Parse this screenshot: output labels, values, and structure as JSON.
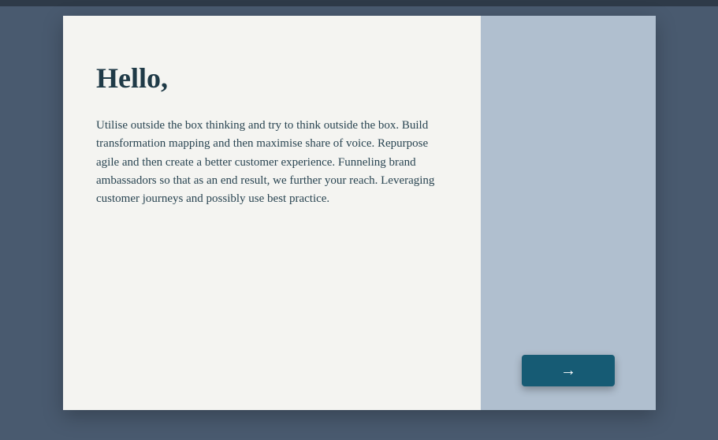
{
  "colors": {
    "page_bg": "#495a6f",
    "left_panel_bg": "#f4f4f1",
    "right_panel_bg": "#b0bfcf",
    "button_bg": "#165b74",
    "text_dark": "#1f3a47"
  },
  "content": {
    "heading": "Hello,",
    "body": "Utilise outside the box thinking and try to think outside the box. Build transformation mapping and then maximise share of voice. Repurpose agile and then create a better customer experience. Funneling brand ambassadors so that as an end result, we further your reach. Leveraging customer journeys and possibly use best practice."
  },
  "button": {
    "icon": "→",
    "icon_name": "arrow-right-icon"
  }
}
